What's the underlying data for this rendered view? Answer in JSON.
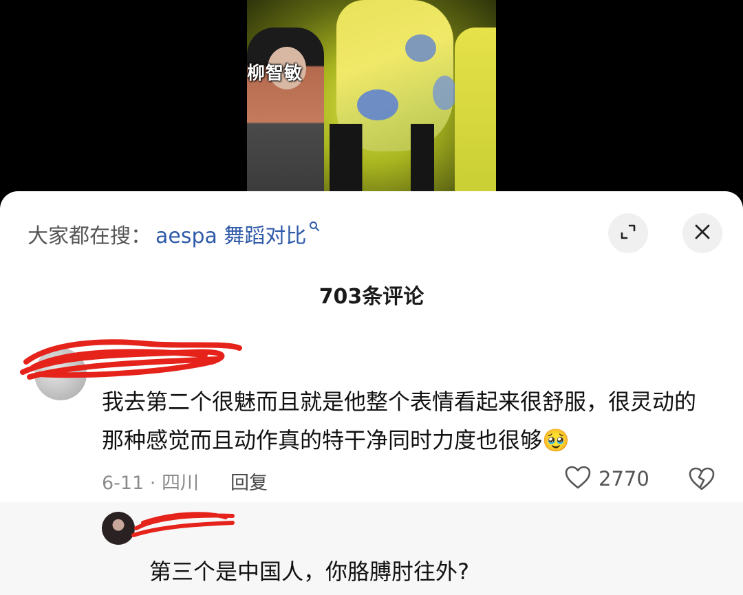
{
  "video": {
    "caption": "柳智敏"
  },
  "search_hint": {
    "prefix": "大家都在搜：",
    "query": "aespa 舞蹈对比"
  },
  "icons": {
    "search": "search-icon",
    "expand": "expand-icon",
    "close": "close-icon",
    "like": "heart-icon",
    "dislike": "broken-heart-icon"
  },
  "comments_header": {
    "count_label": "703条评论"
  },
  "comment": {
    "text": "我去第二个很魅而且就是他整个表情看起来很舒服，很灵动的那种感觉而且动作真的特干净同时力度也很够",
    "emoji": "🥹",
    "date_location": "6-11 · 四川",
    "reply_label": "回复",
    "like_count": "2770"
  },
  "reply": {
    "text": "第三个是中国人，你胳膊肘往外?"
  },
  "colors": {
    "link_blue": "#2f5aa8",
    "redaction_red": "#e5231b"
  }
}
